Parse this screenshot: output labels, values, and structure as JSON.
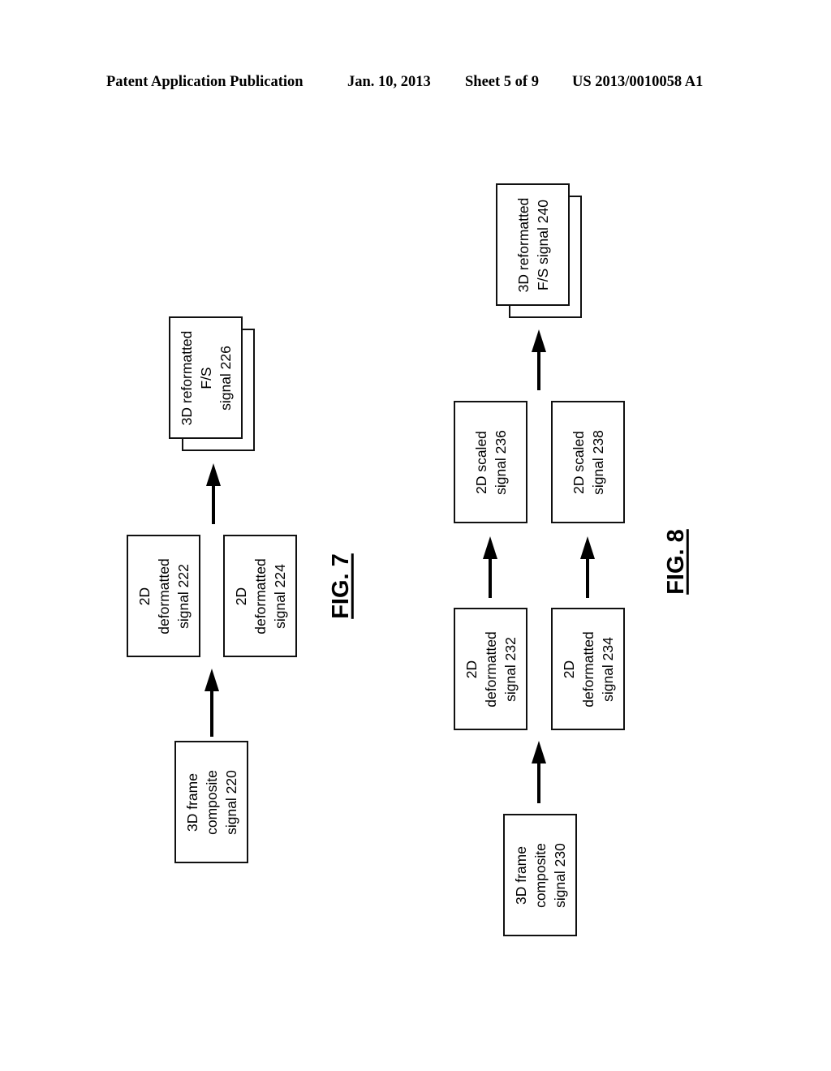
{
  "header": {
    "publication": "Patent Application Publication",
    "date": "Jan. 10, 2013",
    "sheet": "Sheet 5 of 9",
    "number": "US 2013/0010058 A1"
  },
  "fig7": {
    "caption": "FIG. 7",
    "nodes": {
      "n220": "3D frame\ncomposite\nsignal 220",
      "n222": "2D\ndeformatted\nsignal 222",
      "n224": "2D\ndeformatted\nsignal 224",
      "n226": "3D reformatted\nF/S\nsignal 226"
    },
    "edges": [
      {
        "from": "3D frame composite signal 220",
        "to": "2D deformatted signals 222/224"
      },
      {
        "from": "2D deformatted signals 222/224",
        "to": "3D reformatted F/S signal 226"
      }
    ]
  },
  "fig8": {
    "caption": "FIG. 8",
    "nodes": {
      "n230": "3D frame\ncomposite\nsignal 230",
      "n232": "2D\ndeformatted\nsignal 232",
      "n234": "2D\ndeformatted\nsignal 234",
      "n236": "2D scaled\nsignal 236",
      "n238": "2D scaled\nsignal 238",
      "n240": "3D reformatted\nF/S signal 240"
    },
    "edges": [
      {
        "from": "3D frame composite signal 230",
        "to": "2D deformatted signals 232/234"
      },
      {
        "from": "2D deformatted signal 234",
        "to": "2D scaled signal 238"
      },
      {
        "from": "2D deformatted signal 232",
        "to": "2D scaled signal 236"
      },
      {
        "from": "2D scaled signals 236/238",
        "to": "3D reformatted F/S signal 240"
      }
    ]
  }
}
